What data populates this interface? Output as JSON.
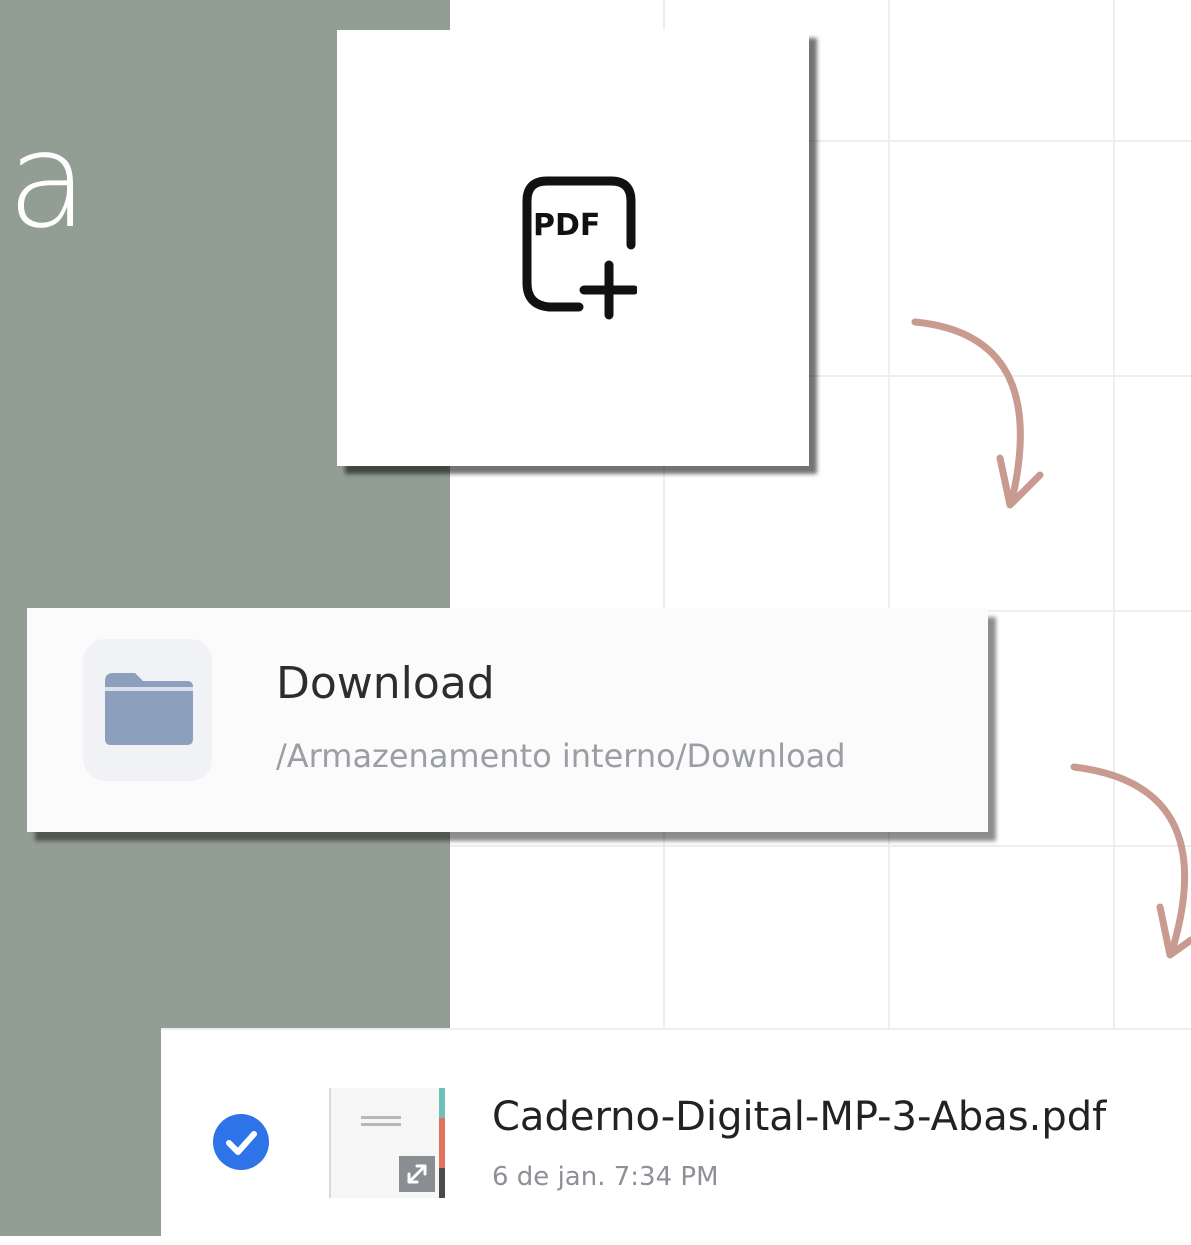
{
  "heading": {
    "fragment": "ga"
  },
  "pdf_add_card": {
    "icon": "pdf-add-icon",
    "icon_label": "PDF"
  },
  "folder": {
    "icon": "folder-icon",
    "title": "Download",
    "path": "/Armazenamento interno/Download"
  },
  "file": {
    "selected": true,
    "name": "Caderno-Digital-MP-3-Abas.pdf",
    "date": "6 de jan. 7:34 PM"
  },
  "colors": {
    "left_panel": "#929d94",
    "arrow": "#c99a8f",
    "check": "#2f73e8",
    "folder": "#8c9fbd"
  }
}
